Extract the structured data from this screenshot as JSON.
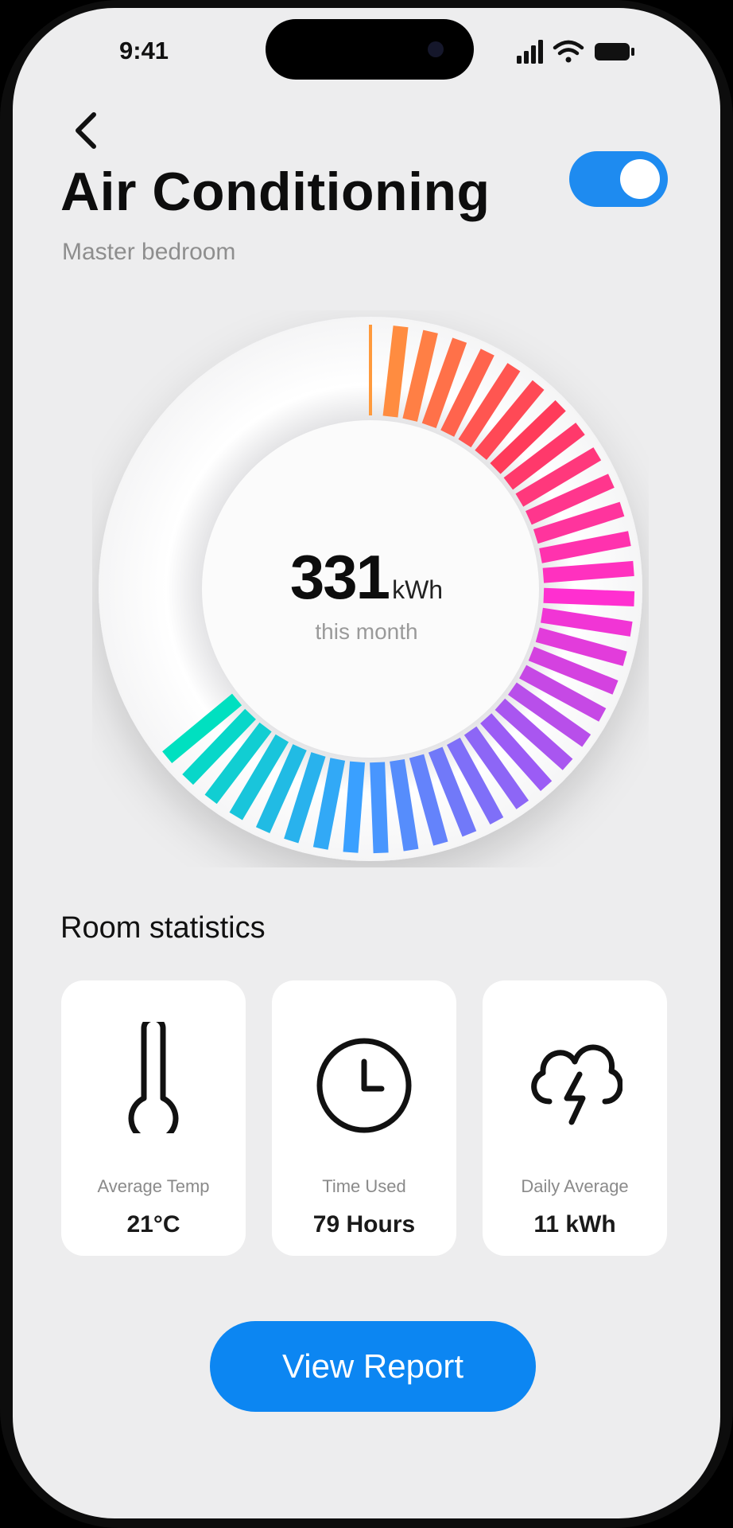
{
  "status_bar": {
    "time": "9:41",
    "icons": [
      "signal-icon",
      "wifi-icon",
      "battery-icon"
    ]
  },
  "header": {
    "back_icon": "chevron-left-icon",
    "title": "Air Conditioning",
    "subtitle": "Master bedroom",
    "power_toggle": {
      "on": true,
      "color": "#1e8bf0"
    }
  },
  "usage_gauge": {
    "value": "331",
    "unit": "kWh",
    "period_label": "this month",
    "fill_fraction": 0.64,
    "gradient_colors": [
      "#ff9a3c",
      "#ff3b5a",
      "#ff2fd0",
      "#9b5cf5",
      "#3aa0ff",
      "#00e0c0"
    ]
  },
  "room_statistics": {
    "title": "Room statistics",
    "cards": [
      {
        "icon": "thermometer-icon",
        "label": "Average Temp",
        "value": "21°C"
      },
      {
        "icon": "clock-icon",
        "label": "Time Used",
        "value": "79 Hours"
      },
      {
        "icon": "storm-cloud-icon",
        "label": "Daily Average",
        "value": "11 kWh"
      }
    ]
  },
  "actions": {
    "view_report_label": "View Report",
    "accent_color": "#0c86f2"
  }
}
